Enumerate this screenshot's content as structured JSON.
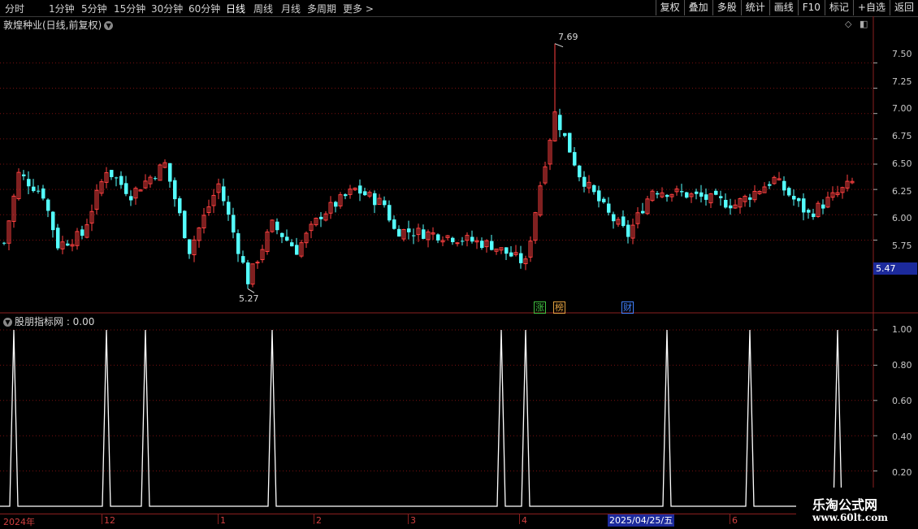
{
  "toolbar": {
    "periods": [
      "分时",
      "1分钟",
      "5分钟",
      "15分钟",
      "30分钟",
      "60分钟",
      "日线",
      "周线",
      "月线",
      "多周期",
      "更多 >"
    ],
    "active_period": "日线",
    "buttons": [
      "复权",
      "叠加",
      "多股",
      "统计",
      "画线",
      "F10",
      "标记",
      "+自选",
      "返回"
    ]
  },
  "stock": {
    "title": "敦煌种业(日线,前复权)"
  },
  "price_axis": {
    "ticks": [
      "7.50",
      "7.25",
      "7.00",
      "6.75",
      "6.50",
      "6.25",
      "6.00",
      "5.75"
    ],
    "current_price": "5.47"
  },
  "annotations": {
    "high": "7.69",
    "low": "5.27"
  },
  "badges": [
    {
      "text": "涨",
      "color": "#40c040"
    },
    {
      "text": "榜",
      "color": "#e0a040"
    },
    {
      "text": "财",
      "color": "#4080ff"
    }
  ],
  "indicator": {
    "title": "股朋指标网 : 0.00",
    "ticks": [
      "1.00",
      "0.80",
      "0.60",
      "0.40",
      "0.20"
    ]
  },
  "date_axis": {
    "labels": [
      "2024年",
      "12",
      "1",
      "2",
      "3",
      "4",
      "6"
    ],
    "highlight": "2025/04/25/五"
  },
  "watermark": {
    "title": "乐淘公式网",
    "url": "www.60lt.com"
  },
  "colors": {
    "up": "#ff4040",
    "down": "#54ffff",
    "grid": "#7a1010",
    "frame": "#8a1f1f",
    "accent": "#1c2a9c"
  },
  "chart_data": {
    "type": "candlestick",
    "ylim": [
      5.2,
      7.8
    ],
    "high_value": 7.69,
    "low_value": 5.27,
    "last_close": 5.47,
    "indicator_ylim": [
      0,
      1
    ],
    "indicator_signals_at": [
      2,
      21,
      29,
      55,
      102,
      107,
      136,
      153,
      171
    ]
  }
}
